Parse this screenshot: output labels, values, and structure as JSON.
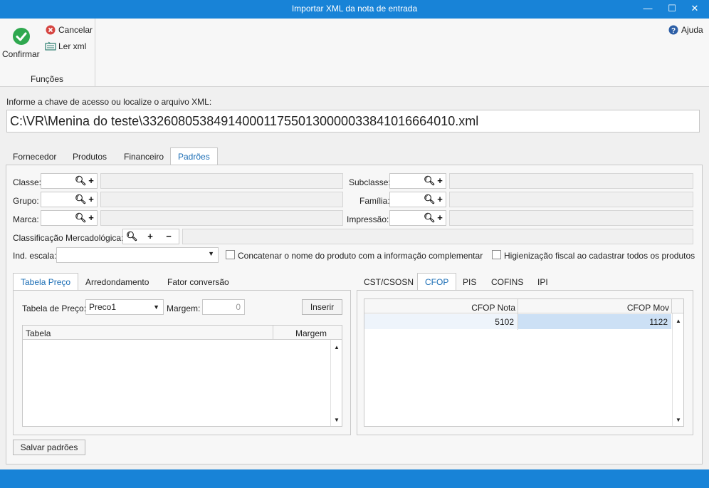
{
  "window": {
    "title": "Importar XML da nota de entrada",
    "minimize_glyph": "—",
    "maximize_glyph": "☐",
    "close_glyph": "✕"
  },
  "ribbon": {
    "confirm_label": "Confirmar",
    "cancel_label": "Cancelar",
    "read_xml_label": "Ler xml",
    "group_label": "Funções",
    "help_label": "Ajuda"
  },
  "file": {
    "prompt": "Informe a chave de acesso ou localize o arquivo XML:",
    "path": "C:\\VR\\Menina do teste\\33260805384914000117550130000033841016664010.xml"
  },
  "main_tabs": [
    "Fornecedor",
    "Produtos",
    "Financeiro",
    "Padrões"
  ],
  "form": {
    "classe": "Classe:",
    "grupo": "Grupo:",
    "marca": "Marca:",
    "subclasse": "Subclasse:",
    "familia": "Família:",
    "impressao": "Impressão:",
    "classificacao": "Classificação Mercadológica:",
    "ind_escala": "Ind. escala:",
    "concatenar": "Concatenar o nome do produto com a informação complementar",
    "higienizacao": "Higienização fiscal ao cadastrar todos os produtos"
  },
  "left_tabs": [
    "Tabela Preço",
    "Arredondamento",
    "Fator conversão"
  ],
  "price": {
    "table_label": "Tabela de Preço:",
    "table_value": "Preco1",
    "margin_label": "Margem:",
    "margin_value": "0",
    "insert_label": "Inserir",
    "columns": [
      "Tabela",
      "Margem"
    ]
  },
  "right_tabs": [
    "CST/CSOSN",
    "CFOP",
    "PIS",
    "COFINS",
    "IPI"
  ],
  "cfop": {
    "columns": [
      "CFOP Nota",
      "CFOP Mov"
    ],
    "rows": [
      {
        "nota": "5102",
        "mov": "1122"
      }
    ]
  },
  "save_label": "Salvar padrões",
  "colors": {
    "accent": "#1883d7",
    "confirm": "#2fa84f",
    "cancel": "#d64541",
    "selected_cell": "#cce0f5"
  }
}
